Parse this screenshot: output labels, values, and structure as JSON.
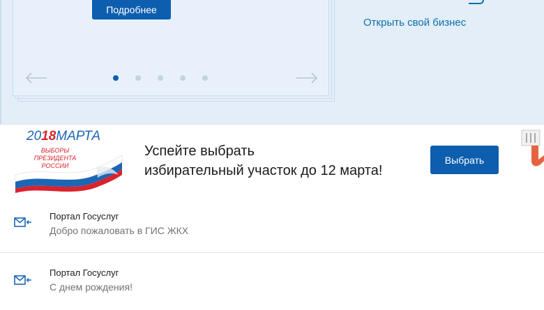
{
  "hero": {
    "more_button": "Подробнее",
    "business_link": "Открыть свой бизнес",
    "slider_dots": 5,
    "active_dot": 1
  },
  "banner": {
    "logo": {
      "date_prefix": "20",
      "date_day": "18",
      "date_month": "МАРТА",
      "subtitle_lines": [
        "ВЫБОРЫ",
        "ПРЕЗИДЕНТА",
        "РОССИИ"
      ]
    },
    "message_lines": [
      "Успейте выбрать",
      "избирательный участок до 12 марта!"
    ],
    "choose_button": "Выбрать"
  },
  "notifications": [
    {
      "sender": "Портал Госуслуг",
      "text": "Добро пожаловать в ГИС ЖКХ",
      "icon": "mail-arrow-icon"
    },
    {
      "sender": "Портал Госуслуг",
      "text": "С днем рождения!",
      "icon": "mail-arrow-icon"
    }
  ],
  "colors": {
    "primary_blue": "#0d5eaf",
    "link_blue": "#0d6fa8",
    "hero_bg": "#e3eef9",
    "accent_red": "#d9232d"
  }
}
